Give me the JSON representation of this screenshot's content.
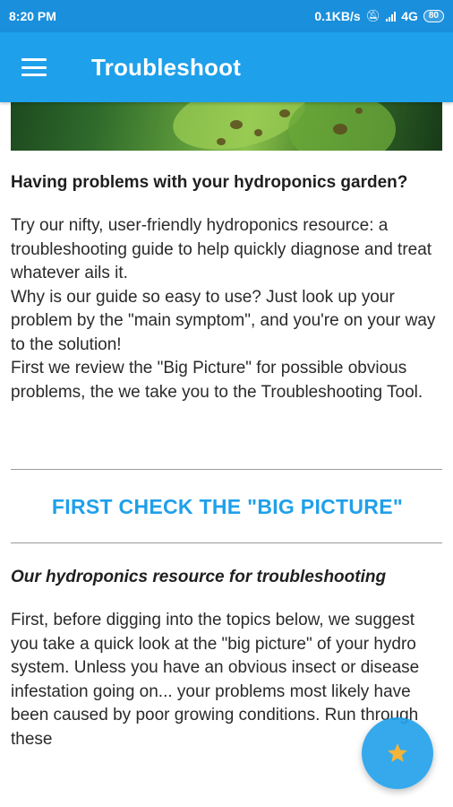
{
  "status_bar": {
    "time": "8:20 PM",
    "speed": "0.1KB/s",
    "network": "4G",
    "battery": "80"
  },
  "app_bar": {
    "title": "Troubleshoot",
    "menu_icon": "hamburger-menu-icon"
  },
  "article": {
    "heading": " Having problems with your hydroponics garden?",
    "intro_paragraphs": [
      "Try our nifty, user-friendly hydroponics resource: a troubleshooting guide to help quickly diagnose and treat whatever ails it.",
      "Why is our guide so easy to use? Just look up your problem by the \"main symptom\", and you're on your way to the solution!",
      "First we review the \"Big Picture\" for possible obvious problems, the we take you to the Troubleshooting Tool."
    ],
    "section_title": "FIRST CHECK THE \"BIG PICTURE\"",
    "subheading": "Our hydroponics resource for troubleshooting",
    "body": "First, before digging into the topics below, we suggest you take a quick look at the \"big picture\" of your hydro system. Unless you have an obvious insect or disease infestation going on... your problems most likely have been caused by poor growing conditions. Run through these"
  },
  "fab": {
    "icon": "star-icon"
  },
  "colors": {
    "status_bar": "#1a8fdc",
    "app_bar": "#1fa0ea",
    "accent": "#1fa0ea",
    "star": "#f4b43a"
  }
}
